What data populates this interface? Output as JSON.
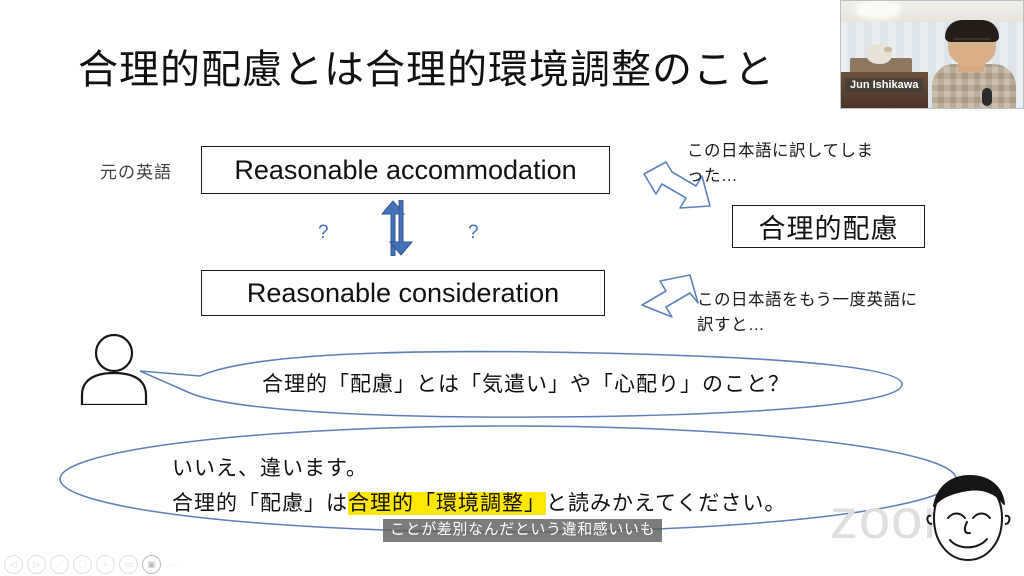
{
  "slide": {
    "title": "合理的配慮とは合理的環境調整のこと",
    "left_label": "元の英語",
    "box_original_english": "Reasonable accommodation",
    "box_back_translation": "Reasonable consideration",
    "box_japanese_term": "合理的配慮",
    "question_mark_left": "?",
    "question_mark_right": "?",
    "note_translated_to_japanese": "この日本語に訳してしまった…",
    "note_retranslate_to_english": "この日本語をもう一度英語に訳すと…",
    "bubble_question": "合理的「配慮」とは「気遣い」や「心配り」のこと？",
    "bubble_answer_line1": "いいえ、違います。",
    "bubble_answer_line2_before": "合理的「配慮」は",
    "bubble_answer_line2_highlight": "合理的「環境調整」",
    "bubble_answer_line2_after": "と読みかえてください。",
    "watermark": "zoom"
  },
  "caption": {
    "text": "ことが差別なんだという違和感いいも"
  },
  "video": {
    "participant_name": "Jun Ishikawa"
  },
  "toolbar": {
    "buttons": [
      {
        "name": "previous-slide-button",
        "glyph": "◁"
      },
      {
        "name": "play-button",
        "glyph": "▷"
      },
      {
        "name": "annotate-pen-button",
        "glyph": "／"
      },
      {
        "name": "screen-share-button",
        "glyph": "⛶"
      },
      {
        "name": "zoom-search-button",
        "glyph": "⌕"
      },
      {
        "name": "chat-button",
        "glyph": "▭"
      },
      {
        "name": "video-camera-button",
        "glyph": "▣"
      },
      {
        "name": "more-options-button",
        "glyph": "···"
      }
    ],
    "active_index": 6
  },
  "colors": {
    "accent_blue": "#4472b8",
    "highlight_yellow": "#ffe800",
    "text_dark": "#101010",
    "caption_bg": "rgba(95,95,95,0.82)"
  }
}
